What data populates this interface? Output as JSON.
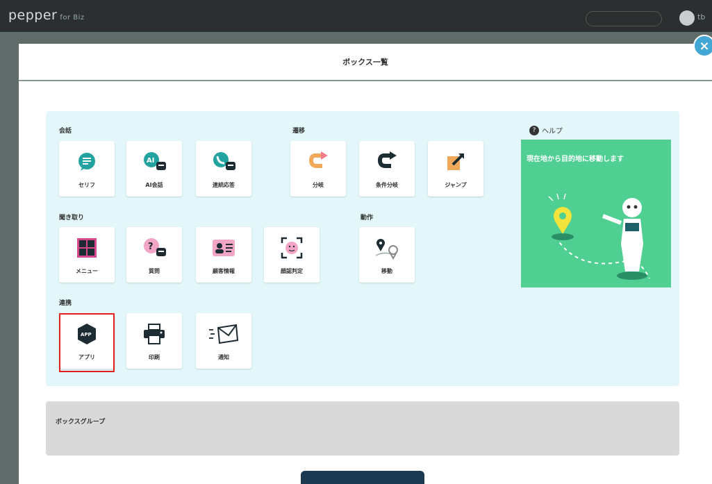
{
  "topbar": {
    "brand": "pepper",
    "brand_sub": "for Biz",
    "user_label": "tb"
  },
  "modal": {
    "title": "ボックス一覧",
    "close_label": "×"
  },
  "sections": {
    "speech": "会話",
    "branch": "遷移",
    "listen": "聞き取り",
    "motion": "動作",
    "other": "連携"
  },
  "tiles": {
    "serif": "セリフ",
    "ai_talk": "AI会話",
    "continuous": "連続応答",
    "branch": "分岐",
    "cond_branch": "条件分岐",
    "jump": "ジャンプ",
    "menu": "メニュー",
    "question": "質問",
    "customer_info": "顧客情報",
    "face": "顔認判定",
    "move": "移動",
    "app": "アプリ",
    "print": "印刷",
    "notify": "通知"
  },
  "help": {
    "label": "ヘルプ",
    "caption": "現在地から目的地に移動します"
  },
  "box_group": {
    "title": "ボックスグループ"
  },
  "colors": {
    "palette_bg": "#e3f7fa",
    "help_bg": "#4fcf92",
    "accent_teal": "#22a39f",
    "accent_pink": "#f3a5c6",
    "accent_orange": "#f2a85b",
    "selection": "#e41d1d"
  }
}
